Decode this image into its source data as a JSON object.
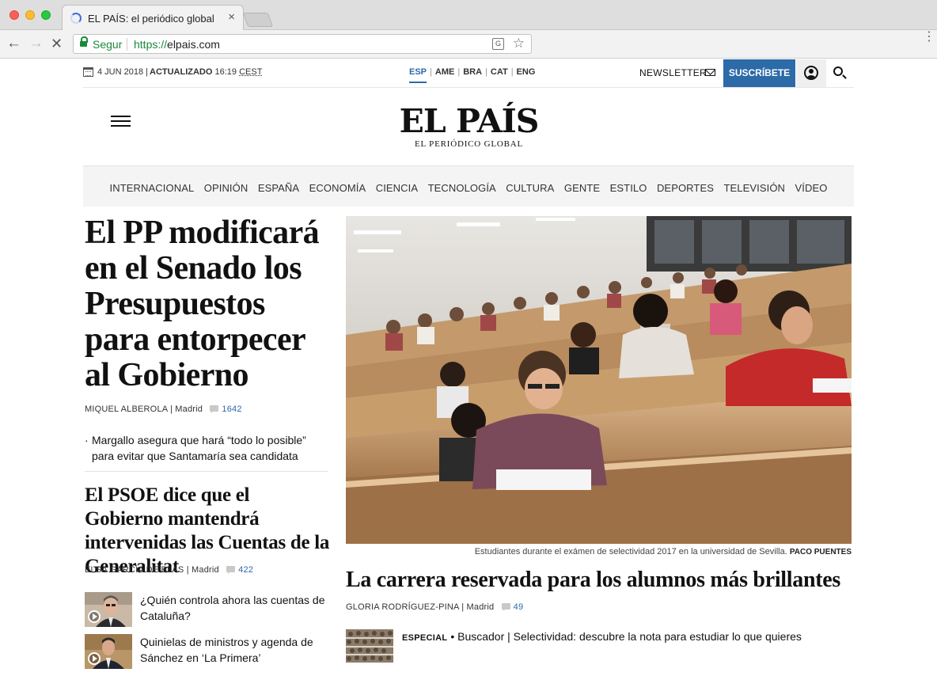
{
  "browser": {
    "tab_title": "EL PAÍS: el periódico global",
    "tab_close": "×",
    "secure_label": "Segur",
    "url_scheme": "https://",
    "url_host": "elpais.com"
  },
  "topbar": {
    "date": "4 JUN 2018 |",
    "updated_label": "ACTUALIZADO",
    "updated_time": "16:19",
    "timezone": "CEST",
    "editions": [
      {
        "label": "ESP",
        "active": true
      },
      {
        "label": "AME",
        "active": false
      },
      {
        "label": "BRA",
        "active": false
      },
      {
        "label": "CAT",
        "active": false
      },
      {
        "label": "ENG",
        "active": false
      }
    ],
    "newsletter_label": "NEWSLETTER",
    "subscribe_label": "SUSCRÍBETE"
  },
  "logo": {
    "title": "EL PAÍS",
    "subtitle": "EL PERIÓDICO GLOBAL"
  },
  "sections": [
    "INTERNACIONAL",
    "OPINIÓN",
    "ESPAÑA",
    "ECONOMÍA",
    "CIENCIA",
    "TECNOLOGÍA",
    "CULTURA",
    "GENTE",
    "ESTILO",
    "DEPORTES",
    "TELEVISIÓN",
    "VÍDEO"
  ],
  "lead": {
    "title": "El PP modificará en el Senado los Presupuestos para entorpecer al Gobierno",
    "author": "MIQUEL ALBEROLA",
    "city": "| Madrid",
    "comments": "1642",
    "related_bullet": "·",
    "related": "Margallo asegura que hará “todo lo posible” para evitar que Santamaría sea candidata"
  },
  "second": {
    "title": "El PSOE dice que el Gobierno mantendrá intervenidas las Cuentas de la Generalitat",
    "author": "ELSA GARCÍA DE BLAS",
    "city": "| Madrid",
    "comments": "422"
  },
  "mini_items": [
    {
      "text": "¿Quién controla ahora las cuentas de Cataluña?"
    },
    {
      "text": "Quinielas de ministros y agenda de Sánchez en ‘La Primera’"
    }
  ],
  "photo": {
    "caption": "Estudiantes durante el exámen de selectividad 2017 en la universidad de Sevilla.",
    "credit": "PACO PUENTES"
  },
  "photo_story": {
    "title": "La carrera reservada para los alumnos más brillantes",
    "author": "GLORIA RODRÍGUEZ-PINA",
    "city": "| Madrid",
    "comments": "49"
  },
  "special": {
    "tag": "ESPECIAL",
    "separator": "•",
    "text": "Buscador | Selectividad: descubre la nota para estudiar lo que quieres"
  },
  "colors": {
    "brand_blue": "#2c6aa8",
    "secure_green": "#1a8a3a"
  }
}
